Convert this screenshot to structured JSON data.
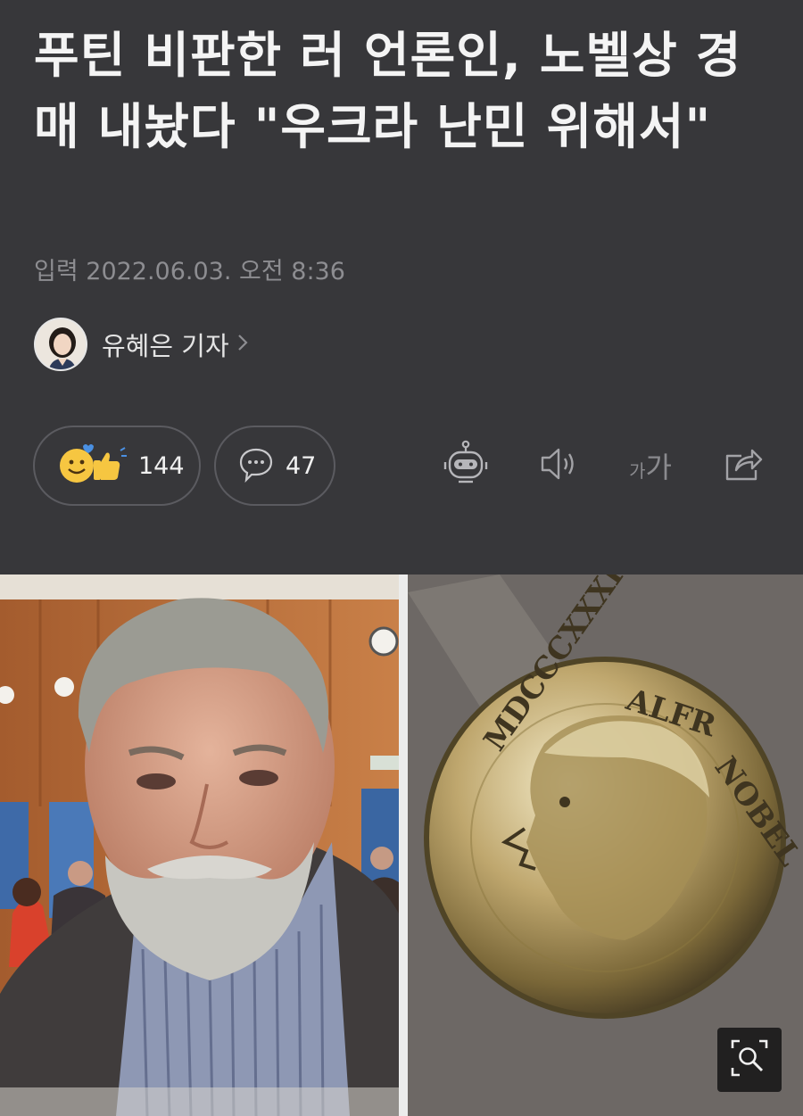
{
  "article": {
    "headline": "푸틴 비판한 러 언론인, 노벨상 경매 내놨다 \"우크라 난민 위해서\"",
    "date": "입력 2022.06.03. 오전 8:36",
    "author": "유혜은 기자"
  },
  "reactions": {
    "like_count": "144",
    "comment_count": "47"
  },
  "toolbar": {
    "font_size_small": "가",
    "font_size_large": "가"
  },
  "icons": [
    "chevron-right-icon",
    "smile-thumbs-up-icon",
    "speech-bubble-icon",
    "robot-summary-icon",
    "speaker-icon",
    "font-size-icon",
    "share-icon",
    "zoom-icon"
  ],
  "colors": {
    "background": "#37373a",
    "headline": "#f4f4f4",
    "meta": "#8d8d91",
    "pill_border": "#5b5b60",
    "like_yellow": "#f6c641",
    "like_blue": "#4a90e2"
  }
}
